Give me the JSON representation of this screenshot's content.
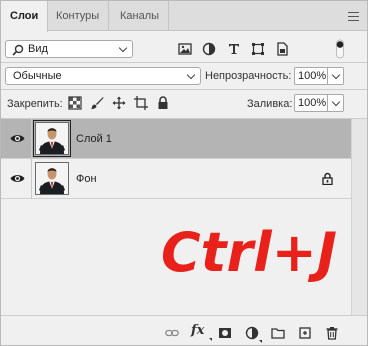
{
  "tabs": [
    {
      "label": "Слои",
      "active": true
    },
    {
      "label": "Контуры",
      "active": false
    },
    {
      "label": "Каналы",
      "active": false
    }
  ],
  "panel_menu_icon": "hamburger-menu-icon",
  "filter": {
    "kind_label": "Вид",
    "icons": [
      "pixel-layer-filter-icon",
      "adjustment-layer-filter-icon",
      "type-layer-filter-icon",
      "shape-layer-filter-icon",
      "smart-object-filter-icon"
    ],
    "toggle": "filter-toggle-icon"
  },
  "blend": {
    "mode": "Обычные",
    "opacity_label": "Непрозрачность:",
    "opacity_value": "100%"
  },
  "lock": {
    "label": "Закрепить:",
    "icons": [
      "lock-transparent-pixels-icon",
      "lock-image-pixels-icon",
      "lock-position-icon",
      "lock-artboard-icon",
      "lock-all-icon"
    ],
    "fill_label": "Заливка:",
    "fill_value": "100%"
  },
  "layers": [
    {
      "name": "Слой 1",
      "visible": true,
      "selected": true,
      "locked": false
    },
    {
      "name": "Фон",
      "visible": true,
      "selected": false,
      "locked": true
    }
  ],
  "overlay_text": "Ctrl+J",
  "overlay_color": "#e8211b",
  "selection_color": "#b4b4b4",
  "bottom_icons": [
    "link-layers-icon",
    "layer-style-fx-icon",
    "add-mask-icon",
    "adjustment-layer-icon",
    "new-group-icon",
    "new-layer-icon",
    "delete-layer-icon"
  ],
  "fx_label": "fx"
}
